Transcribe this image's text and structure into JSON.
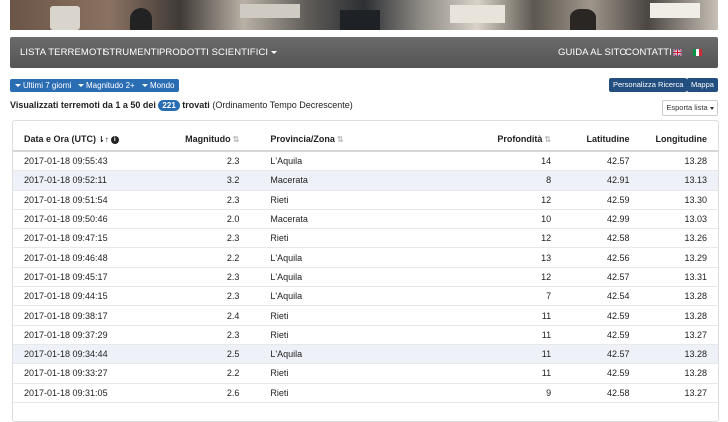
{
  "navbar": {
    "items": [
      "LISTA TERREMOTI",
      "STRUMENTI",
      "PRODOTTI SCIENTIFICI"
    ],
    "right_items": [
      "GUIDA AL SITO",
      "CONTATTI"
    ]
  },
  "toolbar": {
    "filters": [
      "Ultimi 7 giorni",
      "Magnitudo 2+",
      "Mondo"
    ],
    "customize_label": "Personalizza Ricerca",
    "map_label": "Mappa",
    "export_label": "Esporta lista"
  },
  "summary": {
    "prefix": "Visualizzati terremoti da 1 a 50 dei",
    "count": "221",
    "suffix": "trovati",
    "order": "(Ordinamento Tempo Decrescente)"
  },
  "table": {
    "headers": [
      "Data e Ora (UTC)",
      "Magnitudo",
      "Provincia/Zona",
      "Profondità",
      "Latitudine",
      "Longitudine"
    ],
    "rows": [
      [
        "2017-01-18 09:55:43",
        "2.3",
        "L'Aquila",
        "14",
        "42.57",
        "13.28"
      ],
      [
        "2017-01-18 09:52:11",
        "3.2",
        "Macerata",
        "8",
        "42.91",
        "13.13"
      ],
      [
        "2017-01-18 09:51:54",
        "2.3",
        "Rieti",
        "12",
        "42.59",
        "13.30"
      ],
      [
        "2017-01-18 09:50:46",
        "2.0",
        "Macerata",
        "10",
        "42.99",
        "13.03"
      ],
      [
        "2017-01-18 09:47:15",
        "2.3",
        "Rieti",
        "12",
        "42.58",
        "13.26"
      ],
      [
        "2017-01-18 09:46:48",
        "2.2",
        "L'Aquila",
        "13",
        "42.56",
        "13.29"
      ],
      [
        "2017-01-18 09:45:17",
        "2.3",
        "L'Aquila",
        "12",
        "42.57",
        "13.31"
      ],
      [
        "2017-01-18 09:44:15",
        "2.3",
        "L'Aquila",
        "7",
        "42.54",
        "13.28"
      ],
      [
        "2017-01-18 09:38:17",
        "2.4",
        "Rieti",
        "11",
        "42.59",
        "13.28"
      ],
      [
        "2017-01-18 09:37:29",
        "2.3",
        "Rieti",
        "11",
        "42.59",
        "13.27"
      ],
      [
        "2017-01-18 09:34:44",
        "2.5",
        "L'Aquila",
        "11",
        "42.57",
        "13.28"
      ],
      [
        "2017-01-18 09:33:27",
        "2.2",
        "Rieti",
        "11",
        "42.59",
        "13.28"
      ],
      [
        "2017-01-18 09:31:05",
        "2.6",
        "Rieti",
        "9",
        "42.58",
        "13.27"
      ]
    ]
  }
}
